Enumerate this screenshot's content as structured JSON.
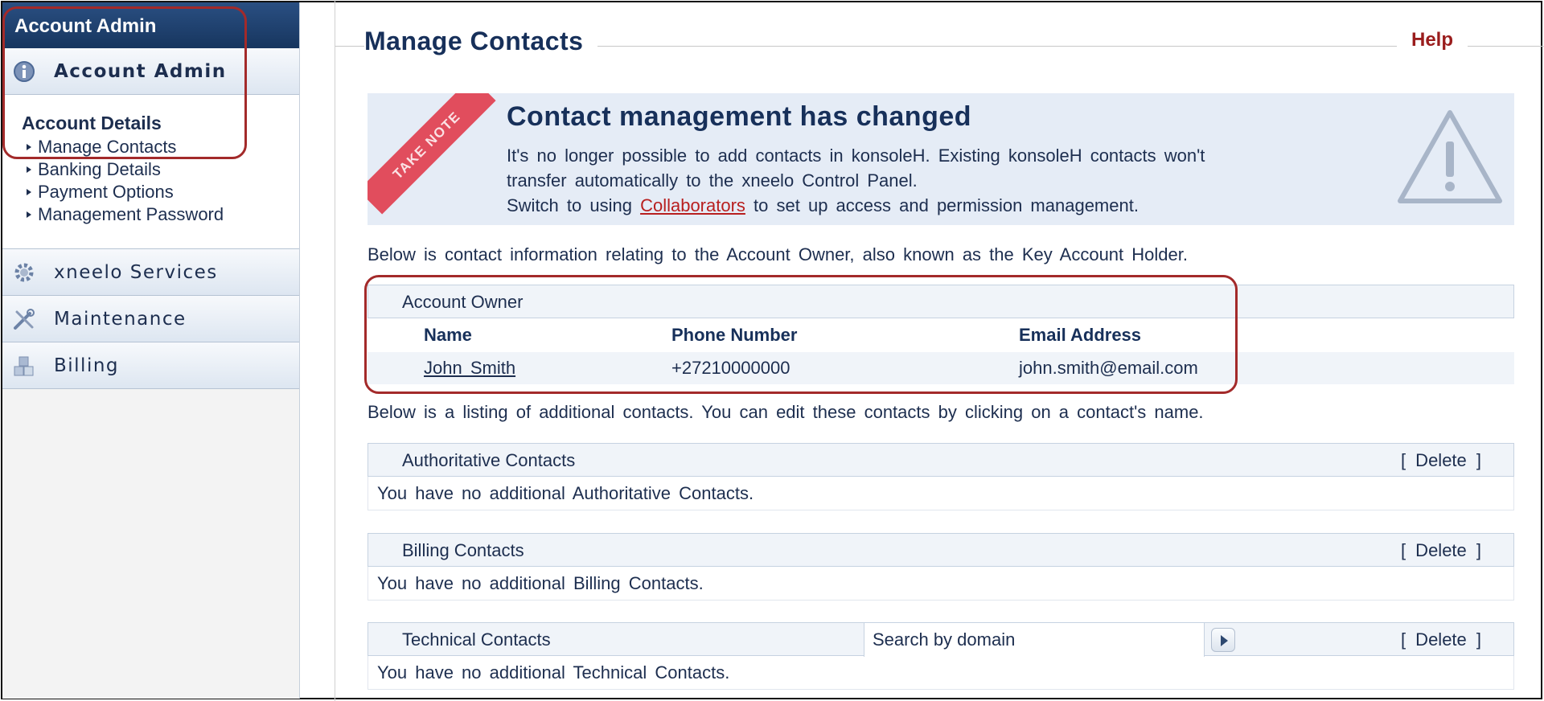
{
  "sidebar": {
    "header": "Account Admin",
    "sections": [
      {
        "label": "Account Admin",
        "icon": "info-icon"
      },
      {
        "label": "xneelo Services",
        "icon": "gear-icon"
      },
      {
        "label": "Maintenance",
        "icon": "tools-icon"
      },
      {
        "label": "Billing",
        "icon": "blocks-icon"
      }
    ],
    "sub_title": "Account Details",
    "sub_items": [
      "Manage Contacts",
      "Banking Details",
      "Payment Options",
      "Management Password"
    ]
  },
  "main": {
    "title": "Manage Contacts",
    "help": "Help",
    "notice": {
      "ribbon": "TAKE NOTE",
      "title": "Contact management has changed",
      "line1": "It's no longer possible to add contacts in konsoleH. Existing konsoleH contacts won't transfer automatically to the xneelo Control Panel.",
      "line2_before": "Switch to using ",
      "line2_link": "Collaborators",
      "line2_after": " to set up access and permission management."
    },
    "owner_intro": "Below is contact information relating to the Account Owner, also known as the Key Account Holder.",
    "owner": {
      "heading": "Account Owner",
      "columns": [
        "Name",
        "Phone Number",
        "Email Address"
      ],
      "row": {
        "name": "John Smith",
        "phone": "+27210000000",
        "email": "john.smith@email.com"
      }
    },
    "additional_intro": "Below is a listing of additional contacts. You can edit these contacts by clicking on a contact's name.",
    "delete_label": "[ Delete ]",
    "panels": [
      {
        "heading": "Authoritative Contacts",
        "empty": "You have no additional Authoritative Contacts."
      },
      {
        "heading": "Billing Contacts",
        "empty": "You have no additional Billing Contacts."
      },
      {
        "heading": "Technical Contacts",
        "empty": "You have no additional Technical Contacts.",
        "search_placeholder": "Search by domain"
      }
    ]
  },
  "colors": {
    "accent": "#17305a",
    "annotation": "#a32a2a",
    "link": "#b81f1f",
    "ribbon": "#e14d5d"
  }
}
